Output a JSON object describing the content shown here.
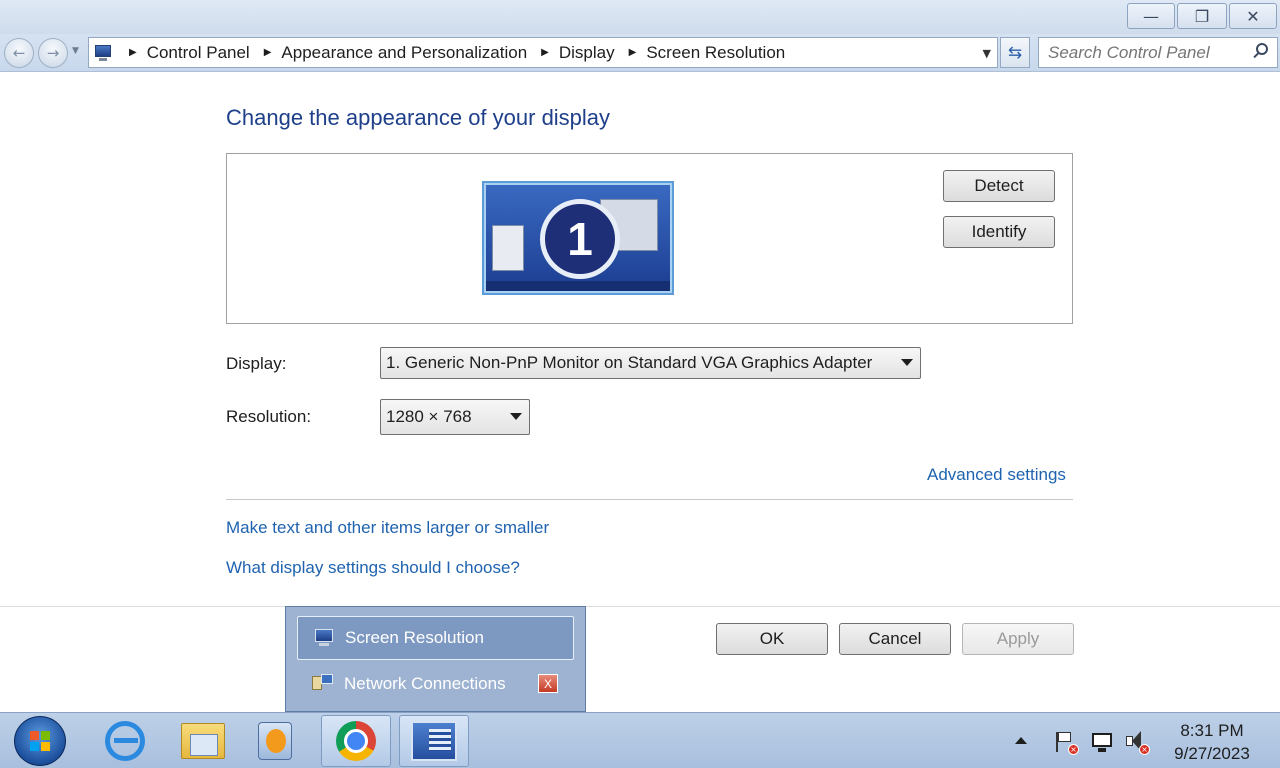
{
  "window": {
    "minimize_glyph": "—",
    "maximize_glyph": "❐",
    "close_glyph": "✕"
  },
  "address_bar": {
    "breadcrumbs": [
      "Control Panel",
      "Appearance and Personalization",
      "Display",
      "Screen Resolution"
    ],
    "search_placeholder": "Search Control Panel"
  },
  "main": {
    "title": "Change the appearance of your display",
    "monitor_number": "1",
    "detect_label": "Detect",
    "identify_label": "Identify",
    "display_label": "Display:",
    "display_value": "1. Generic Non-PnP Monitor on Standard VGA Graphics Adapter",
    "resolution_label": "Resolution:",
    "resolution_value": "1280 × 768",
    "advanced_link": "Advanced settings",
    "text_size_link": "Make text and other items larger or smaller",
    "help_link": "What display settings should I choose?"
  },
  "footer": {
    "ok_label": "OK",
    "cancel_label": "Cancel",
    "apply_label": "Apply"
  },
  "jump_list": {
    "items": [
      "Screen Resolution",
      "Network Connections"
    ],
    "close_glyph": "X"
  },
  "taskbar": {
    "apps": [
      "internet-explorer-icon",
      "file-explorer-icon",
      "media-player-icon",
      "chrome-icon",
      "control-panel-icon"
    ],
    "clock_time": "8:31 PM",
    "clock_date": "9/27/2023"
  }
}
